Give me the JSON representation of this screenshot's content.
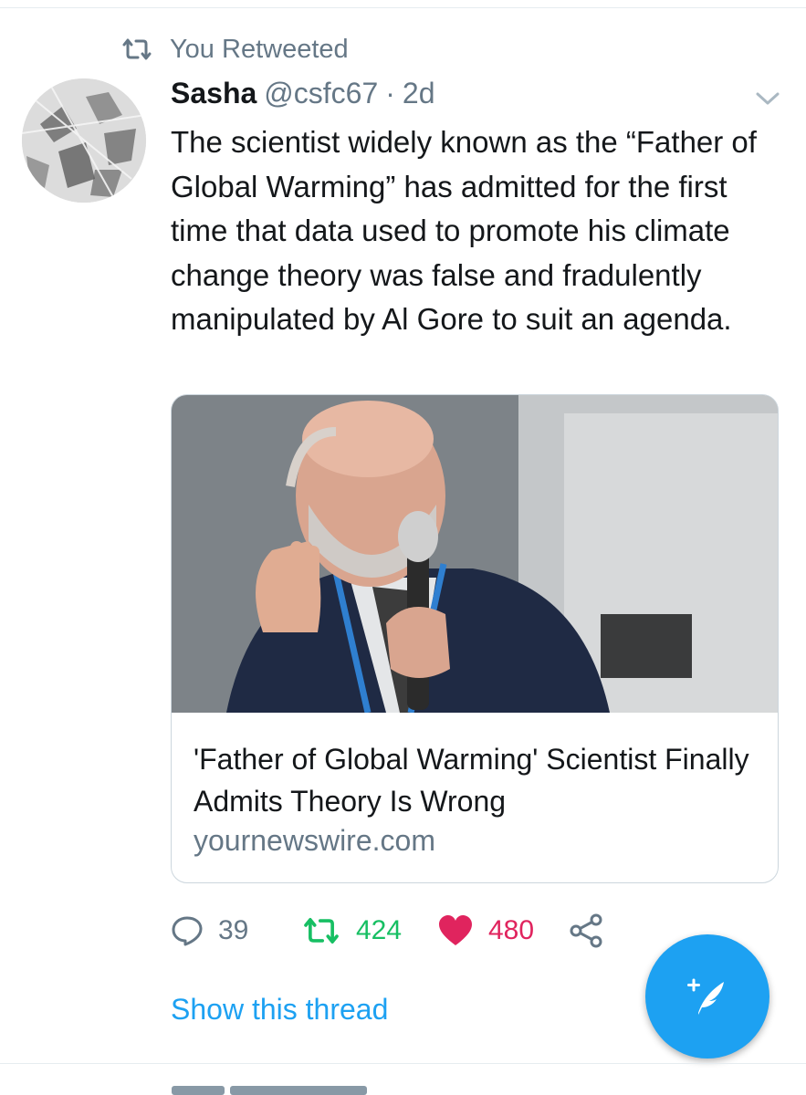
{
  "retweet_context": {
    "label": "You Retweeted",
    "icon": "retweet-icon"
  },
  "tweet": {
    "author_name": "Sasha",
    "author_handle": "@csfc67",
    "separator": "·",
    "time": "2d",
    "text": "The scientist widely known as the “Father of Global Warming” has admitted for the first time that data used to promote his climate change theory was false and fradulently manipulated by Al Gore to suit an agenda.",
    "card": {
      "title": "'Father of Global Warming' Scientist Finally Admits Theory Is Wrong",
      "domain": "yournewswire.com"
    },
    "actions": {
      "replies": "39",
      "retweets": "424",
      "likes": "480"
    },
    "show_thread": "Show this thread"
  },
  "colors": {
    "text": "#14171a",
    "secondary": "#657786",
    "link": "#1da1f2",
    "retweet": "#17bf63",
    "like": "#e0245e",
    "fab": "#1da1f2"
  },
  "icons": [
    "retweet-icon",
    "chevron-down-icon",
    "reply-icon",
    "like-icon",
    "share-icon",
    "compose-tweet-icon"
  ]
}
